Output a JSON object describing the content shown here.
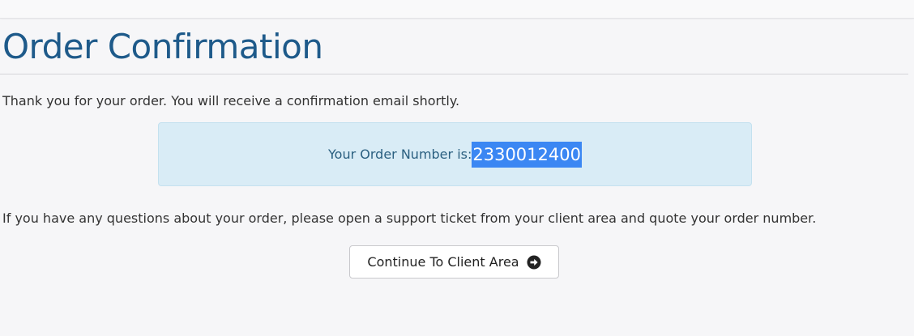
{
  "page": {
    "title": "Order Confirmation",
    "thanks_message": "Thank you for your order. You will receive a confirmation email shortly.",
    "questions_message": "If you have any questions about your order, please open a support ticket from your client area and quote your order number."
  },
  "order": {
    "label": "Your Order Number is: ",
    "number": "2330012400"
  },
  "actions": {
    "continue_label": "Continue To Client Area",
    "continue_icon": "arrow-circle-right-icon"
  },
  "colors": {
    "title": "#1e5a8a",
    "info_box_background": "#d9ecf6",
    "selection_highlight": "#3b87f3"
  }
}
